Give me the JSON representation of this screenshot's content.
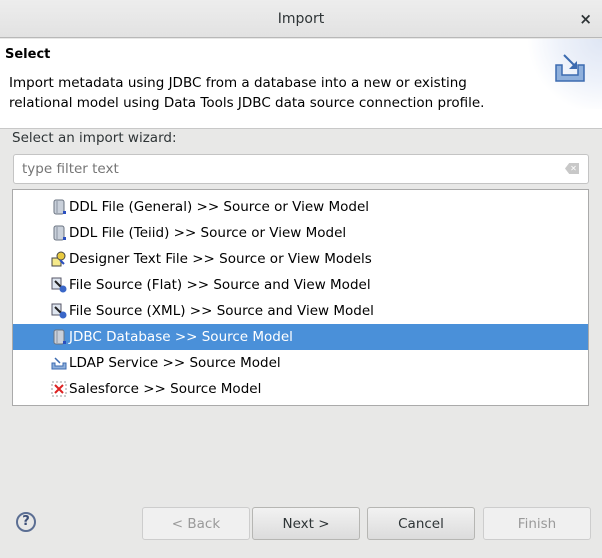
{
  "window": {
    "title": "Import",
    "close_icon": "×"
  },
  "header": {
    "title": "Select",
    "description": "Import metadata using JDBC from a database into a new or existing relational model using Data Tools JDBC data source connection profile."
  },
  "wizard": {
    "label": "Select an import wizard:",
    "filter_placeholder": "type filter text",
    "filter_value": ""
  },
  "items": [
    {
      "label": "DDL File (General) >> Source or View Model",
      "icon": "database"
    },
    {
      "label": "DDL File (Teiid) >> Source or View Model",
      "icon": "database"
    },
    {
      "label": "Designer Text File >> Source or View Models",
      "icon": "text-file"
    },
    {
      "label": "File Source (Flat) >> Source and View Model",
      "icon": "file-source"
    },
    {
      "label": "File Source (XML) >> Source and View Model",
      "icon": "file-source"
    },
    {
      "label": "JDBC Database >> Source Model",
      "icon": "database",
      "selected": true
    },
    {
      "label": "LDAP Service >> Source Model",
      "icon": "import"
    },
    {
      "label": "Salesforce >> Source Model",
      "icon": "salesforce"
    }
  ],
  "buttons": {
    "back": "< Back",
    "next": "Next >",
    "cancel": "Cancel",
    "finish": "Finish",
    "help": "?"
  },
  "colors": {
    "selection": "#4a90d9"
  }
}
